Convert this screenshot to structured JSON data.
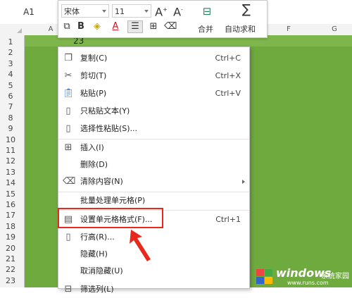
{
  "namebox": "A1",
  "toolbar": {
    "font_name": "宋体",
    "font_size": "11",
    "grow_icon": "A⁺",
    "shrink_icon": "A⁻",
    "merge_label": "合并",
    "autosum_label": "自动求和"
  },
  "columns": [
    "A",
    "F",
    "G"
  ],
  "rows": [
    "1",
    "2",
    "3",
    "4",
    "5",
    "6",
    "7",
    "8",
    "9",
    "10",
    "11",
    "12",
    "13",
    "14",
    "15",
    "16",
    "17",
    "18",
    "19",
    "20",
    "21",
    "22",
    "23"
  ],
  "cell_value": "23",
  "menu": {
    "items": [
      {
        "label": "复制(C)",
        "shortcut": "Ctrl+C",
        "icon": "copy-icon"
      },
      {
        "label": "剪切(T)",
        "shortcut": "Ctrl+X",
        "icon": "scissors-icon"
      },
      {
        "label": "粘贴(P)",
        "shortcut": "Ctrl+V",
        "icon": "paste-icon"
      },
      {
        "label": "只粘贴文本(Y)",
        "shortcut": "",
        "icon": "paste-text-icon"
      },
      {
        "label": "选择性粘贴(S)...",
        "shortcut": "",
        "icon": "paste-special-icon"
      },
      {
        "label": "插入(I)",
        "shortcut": "",
        "icon": "insert-icon"
      },
      {
        "label": "删除(D)",
        "shortcut": "",
        "icon": ""
      },
      {
        "label": "清除内容(N)",
        "shortcut": "",
        "icon": "eraser-icon"
      },
      {
        "label": "批量处理单元格(P)",
        "shortcut": "",
        "icon": ""
      },
      {
        "label": "设置单元格格式(F)...",
        "shortcut": "Ctrl+1",
        "icon": "format-cells-icon"
      },
      {
        "label": "行高(R)...",
        "shortcut": "",
        "icon": "row-height-icon"
      },
      {
        "label": "隐藏(H)",
        "shortcut": "",
        "icon": ""
      },
      {
        "label": "取消隐藏(U)",
        "shortcut": "",
        "icon": ""
      },
      {
        "label": "筛选列(L)",
        "shortcut": "",
        "icon": "filter-icon"
      }
    ]
  },
  "watermark": {
    "brand": "windows",
    "site": "系统家园",
    "url": "www.runs.com"
  },
  "colors": {
    "sheet_green": "#6faa3e",
    "highlight_red": "#e8281c"
  }
}
